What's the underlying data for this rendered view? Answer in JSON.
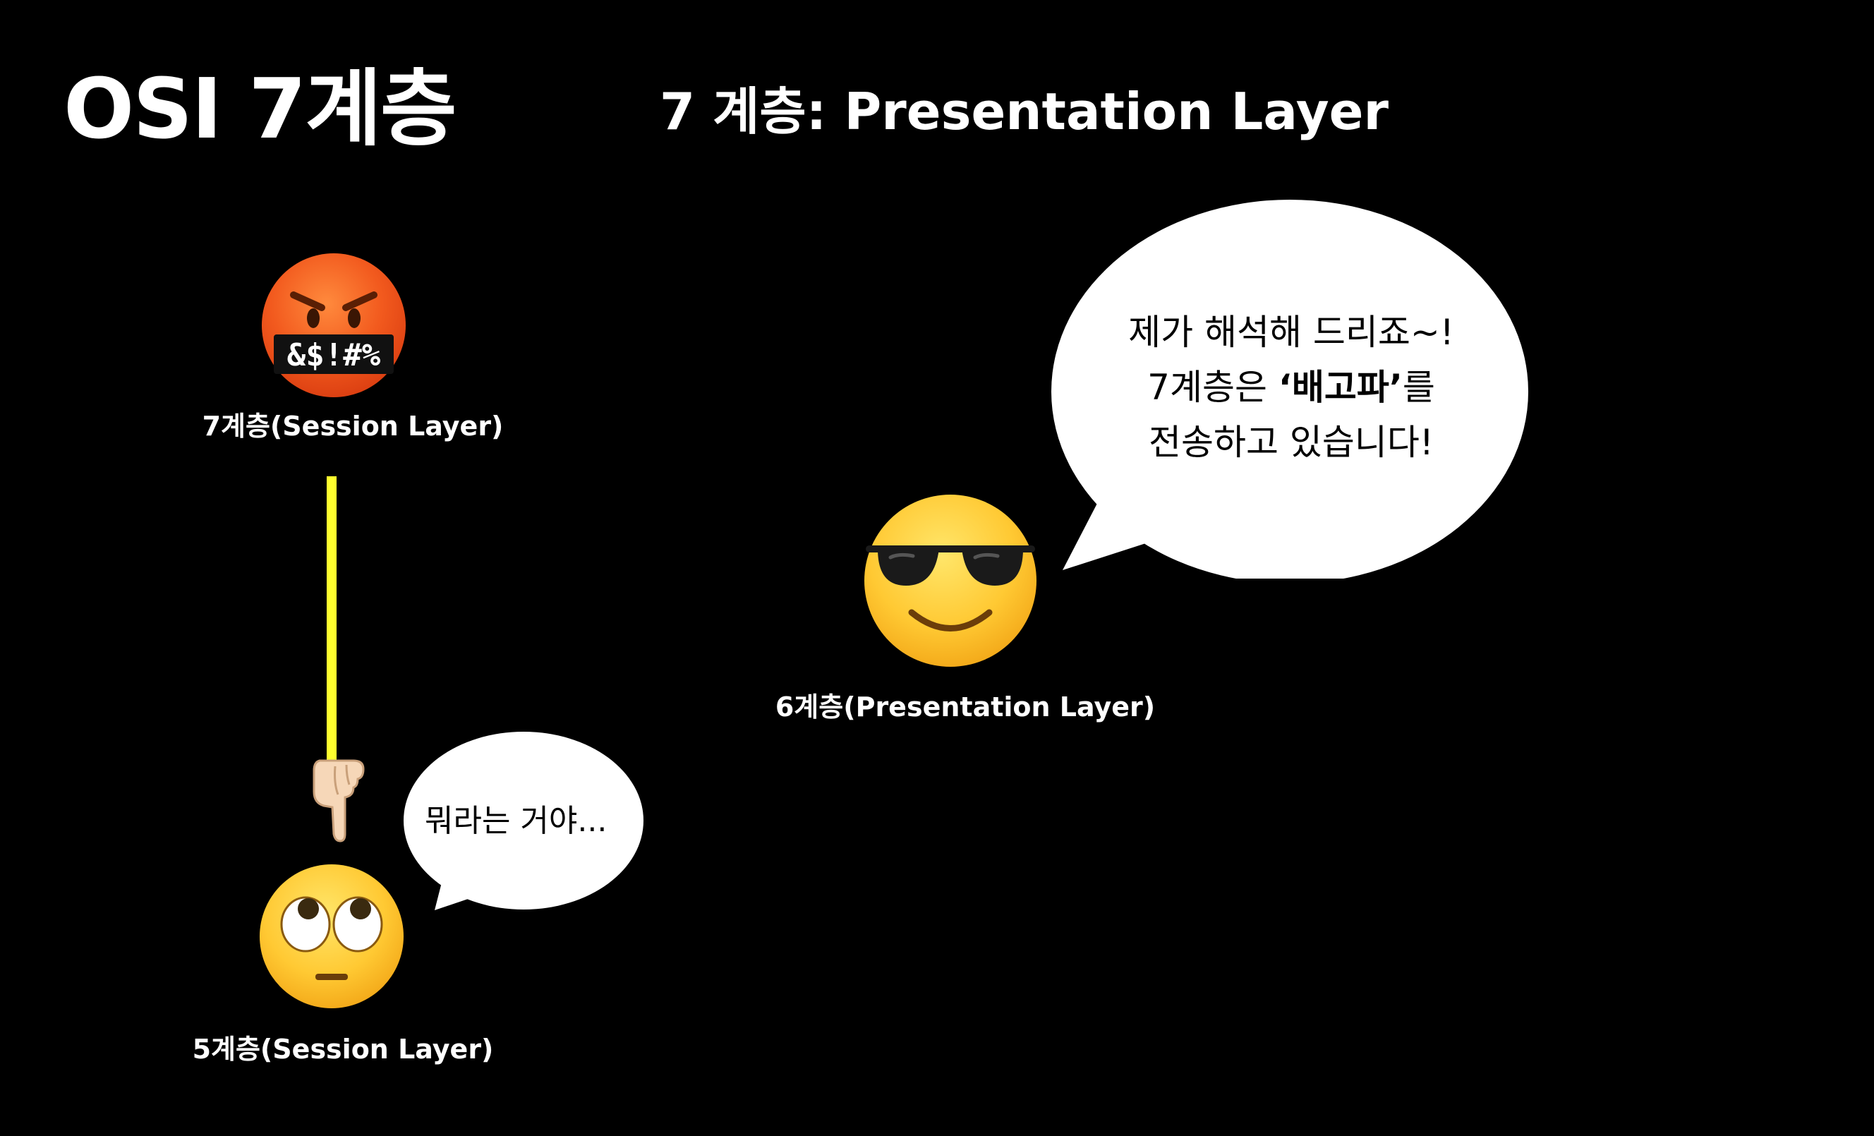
{
  "slide": {
    "title": "OSI 7계층",
    "subtitle": "7 계층: Presentation Layer"
  },
  "characters": {
    "top": {
      "icon": "cursing-face-icon",
      "symbols": "&$!#%",
      "label": "7계층(Session Layer)"
    },
    "bottom": {
      "icon": "eye-roll-face-icon",
      "label": "5계층(Session Layer)",
      "speech": "뭐라는 거야..."
    },
    "presenter": {
      "icon": "sunglasses-face-icon",
      "label": "6계층(Presentation Layer)",
      "speech": {
        "line1": "제가 해석해 드리죠~!",
        "line2_prefix": "7계층은 ",
        "line2_bold": "‘배고파’",
        "line2_suffix": "를",
        "line3": "전송하고 있습니다!"
      }
    }
  },
  "connector": {
    "color": "#ffff2e",
    "pointer_icon": "pointing-down-hand-icon"
  },
  "colors": {
    "background": "#000000",
    "text": "#ffffff",
    "bubble": "#ffffff"
  }
}
